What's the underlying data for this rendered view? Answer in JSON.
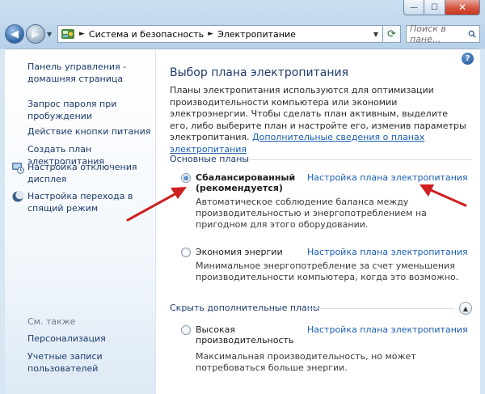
{
  "window": {
    "min_glyph": "—",
    "max_glyph": "☐",
    "close_glyph": "✕"
  },
  "navbar": {
    "breadcrumb": [
      "Система и безопасность",
      "Электропитание"
    ],
    "separator": "►",
    "search_placeholder": "Поиск в пане...",
    "back_icon": "back-arrow-icon",
    "forward_icon": "forward-arrow-icon",
    "refresh_icon": "refresh-icon",
    "search_icon": "search-icon"
  },
  "sidebar": {
    "links": [
      {
        "label": "Панель управления - домашняя страница"
      },
      {
        "label": "Запрос пароля при пробуждении"
      },
      {
        "label": "Действие кнопки питания"
      },
      {
        "label": "Создать план электропитания"
      },
      {
        "label": "Настройка отключения дисплея",
        "icon": "display-clock-icon"
      },
      {
        "label": "Настройка перехода в спящий режим",
        "icon": "moon-icon"
      }
    ],
    "see_also": "См. также",
    "see_also_links": [
      {
        "label": "Персонализация"
      },
      {
        "label": "Учетные записи пользователей"
      }
    ]
  },
  "main": {
    "help_glyph": "?",
    "title": "Выбор плана электропитания",
    "intro": "Планы электропитания используются для оптимизации производительности компьютера или экономии электроэнергии. Чтобы сделать план активным, выделите его, либо выберите план и настройте его, изменив параметры электропитания. ",
    "intro_link": "Дополнительные сведения о планах электропитания",
    "basic_group": "Основные планы",
    "hidden_group": "Скрыть дополнительные планы",
    "plans": [
      {
        "name": "Сбалансированный (рекомендуется)",
        "selected": true,
        "link": "Настройка плана электропитания",
        "desc": "Автоматическое соблюдение баланса между производительностью и энергопотреблением на пригодном для этого оборудовании."
      },
      {
        "name": "Экономия энергии",
        "selected": false,
        "link": "Настройка плана электропитания",
        "desc": "Минимальное энергопотребление за счет уменьшения производительности компьютера, когда это возможно."
      },
      {
        "name": "Высокая производительность",
        "selected": false,
        "link": "Настройка плана электропитания",
        "desc": "Максимальная производительность, но может потребоваться больше энергии."
      }
    ]
  },
  "colors": {
    "link": "#1a5db4",
    "annotation_arrow": "#d01f1f"
  }
}
